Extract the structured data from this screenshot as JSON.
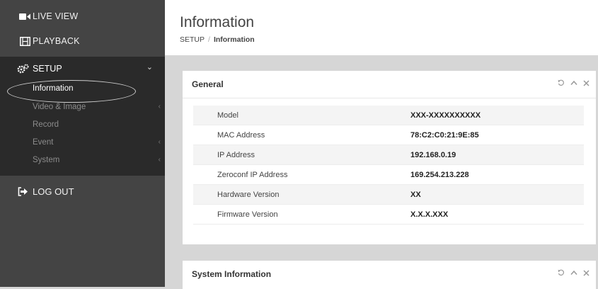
{
  "sidebar": {
    "live_view": "LIVE VIEW",
    "playback": "PLAYBACK",
    "setup": "SETUP",
    "sub_items": [
      {
        "label": "Information"
      },
      {
        "label": "Video & Image"
      },
      {
        "label": "Record"
      },
      {
        "label": "Event"
      },
      {
        "label": "System"
      }
    ],
    "logout": "LOG OUT"
  },
  "header": {
    "title": "Information",
    "breadcrumb_root": "SETUP",
    "breadcrumb_sep": "/",
    "breadcrumb_current": "Information"
  },
  "general": {
    "title": "General",
    "rows": [
      {
        "key": "Model",
        "value": "XXX-XXXXXXXXXX"
      },
      {
        "key": "MAC Address",
        "value": "78:C2:C0:21:9E:85"
      },
      {
        "key": "IP Address",
        "value": "192.168.0.19"
      },
      {
        "key": "Zeroconf IP Address",
        "value": "169.254.213.228"
      },
      {
        "key": "Hardware Version",
        "value": "XX"
      },
      {
        "key": "Firmware Version",
        "value": "X.X.X.XXX"
      }
    ]
  },
  "system_info": {
    "title": "System Information"
  }
}
